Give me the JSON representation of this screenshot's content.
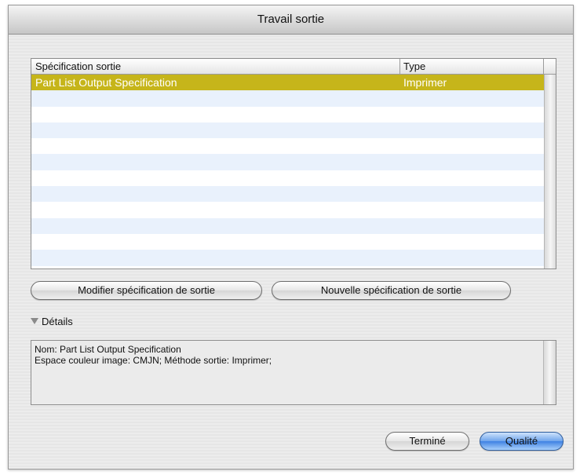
{
  "window": {
    "title": "Travail sortie"
  },
  "table": {
    "headers": [
      "Spécification sortie",
      "Type"
    ],
    "rows": [
      {
        "spec": "Part List Output Specification",
        "type": "Imprimer"
      },
      {
        "spec": "",
        "type": ""
      },
      {
        "spec": "",
        "type": ""
      },
      {
        "spec": "",
        "type": ""
      },
      {
        "spec": "",
        "type": ""
      },
      {
        "spec": "",
        "type": ""
      },
      {
        "spec": "",
        "type": ""
      },
      {
        "spec": "",
        "type": ""
      },
      {
        "spec": "",
        "type": ""
      },
      {
        "spec": "",
        "type": ""
      },
      {
        "spec": "",
        "type": ""
      },
      {
        "spec": "",
        "type": ""
      }
    ]
  },
  "buttons": {
    "modify": "Modifier spécification de sortie",
    "new": "Nouvelle spécification de sortie",
    "done": "Terminé",
    "quality": "Qualité"
  },
  "details": {
    "toggle_label": "Détails",
    "line1": "Nom: Part List Output Specification",
    "line2": "Espace couleur image: CMJN; Méthode sortie: Imprimer;"
  },
  "colors": {
    "selection": "#c6b51a",
    "alt_row": "#e9f1fc",
    "default_button": "#3f82e3"
  }
}
